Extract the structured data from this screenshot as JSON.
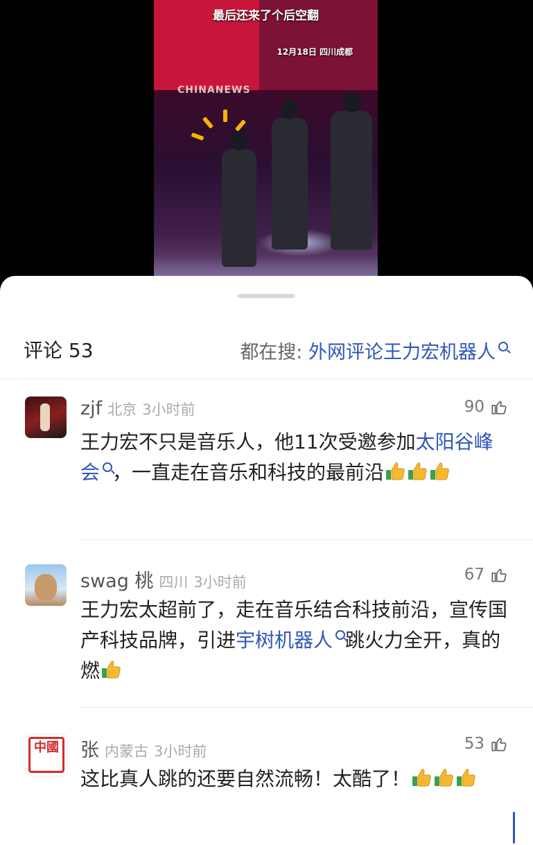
{
  "video": {
    "caption": "最后还来了个后空翻",
    "date_location": "12月18日 四川成都",
    "watermark": "CHINANEWS"
  },
  "comments_panel": {
    "title": "评论 53",
    "trending_label": "都在搜: ",
    "trending_term": "外网评论王力宏机器人",
    "search_icon": "search-icon",
    "like_icon": "thumbs-up-outline-icon",
    "emoji_icon": "thumbs-up-emoji-icon"
  },
  "comments": [
    {
      "avatar_icon": "avatar-performer-photo",
      "username": "zjf",
      "location": "北京",
      "time": "3小时前",
      "likes": "90",
      "text_before": "王力宏不只是音乐人，他11次受邀参加",
      "link": "太阳谷峰会",
      "text_after": "，一直走在音乐和科技的最前沿"
    },
    {
      "avatar_icon": "avatar-rabbit-illustration",
      "username": "swag 桃",
      "location": "四川",
      "time": "3小时前",
      "likes": "67",
      "text_before": "王力宏太超前了，走在音乐结合科技前沿，宣传国产科技品牌，引进",
      "link": "宇树机器人",
      "text_after": "跳火力全开，真的燃"
    },
    {
      "avatar_icon": "avatar-red-seal",
      "avatar_text": "中國",
      "username": "张",
      "location": "内蒙古",
      "time": "3小时前",
      "likes": "53",
      "text_before": "这比真人跳的还要自然流畅！太酷了！"
    }
  ]
}
